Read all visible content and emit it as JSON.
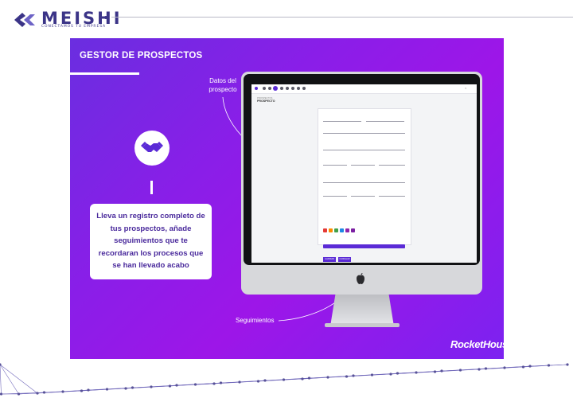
{
  "header": {
    "brand_name": "MEISHI",
    "tagline": "CONECTAMOS TU EMPRESA",
    "brand_color": "#3b3487"
  },
  "slide": {
    "title": "GESTOR DE PROSPECTOS",
    "background_colors": [
      "#6a2ee0",
      "#9d16e8",
      "#7c22f0"
    ],
    "icon": "handshake-icon",
    "info_text": "Lleva un registro completo de tus prospectos, añade seguimientos que te recordaran los procesos que se han llevado acabo",
    "label_datos": "Datos del prospecto",
    "label_seguimientos": "Seguimientos",
    "watermark": "RocketHouse"
  },
  "screen": {
    "accent_color": "#5b2bd6",
    "breadcrumb": "PROSPECTOS",
    "page_title": "PROSPECTO",
    "buttons": [
      "GUARDAR",
      "CANCELAR"
    ]
  },
  "colors": {
    "swatches": [
      "#e53935",
      "#fb8c00",
      "#43a047",
      "#1e88e5",
      "#8e24aa",
      "#7b1fa2"
    ]
  }
}
